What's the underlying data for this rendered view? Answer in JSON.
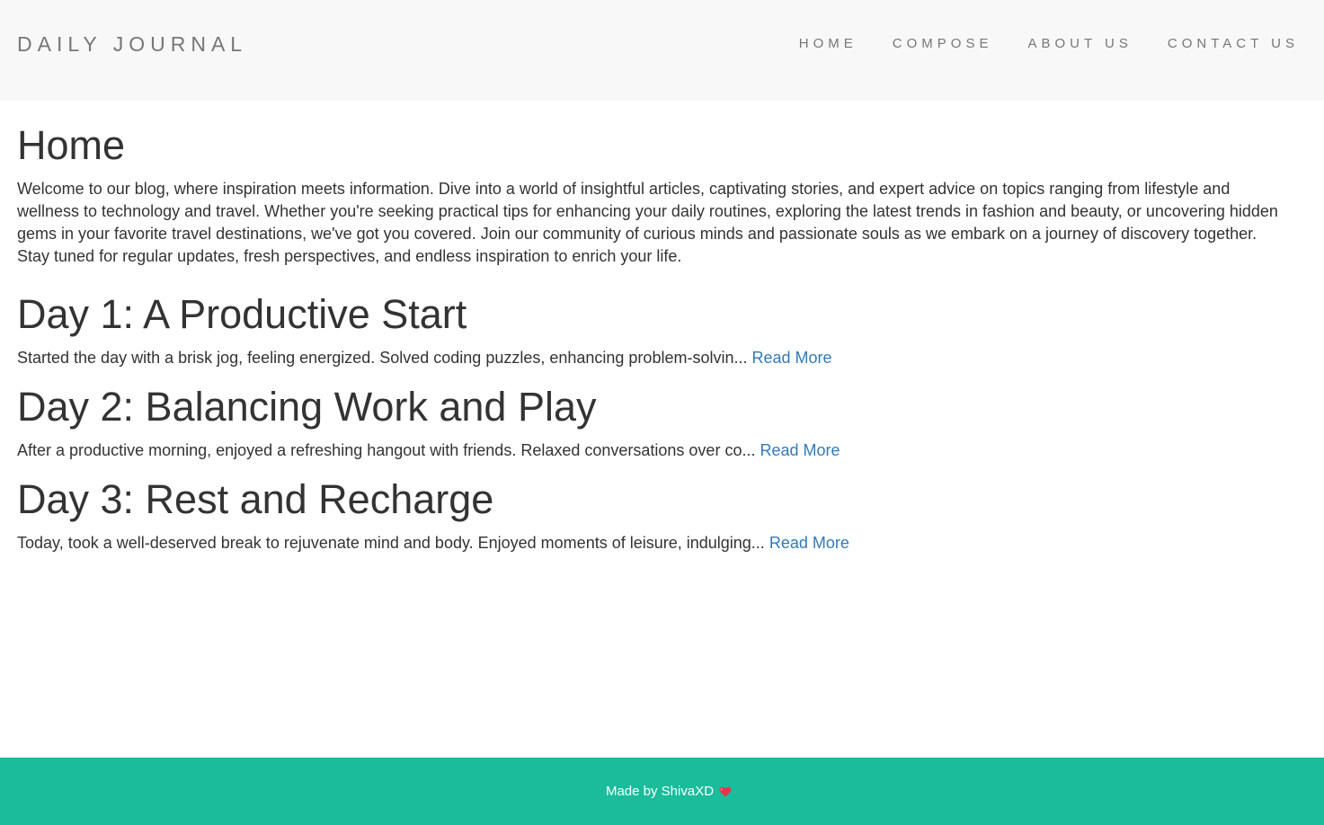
{
  "header": {
    "brand": "DAILY JOURNAL",
    "nav": [
      {
        "label": "HOME"
      },
      {
        "label": "COMPOSE"
      },
      {
        "label": "ABOUT US"
      },
      {
        "label": "CONTACT US"
      }
    ]
  },
  "main": {
    "title": "Home",
    "intro": "Welcome to our blog, where inspiration meets information. Dive into a world of insightful articles, captivating stories, and expert advice on topics ranging from lifestyle and wellness to technology and travel. Whether you're seeking practical tips for enhancing your daily routines, exploring the latest trends in fashion and beauty, or uncovering hidden gems in your favorite travel destinations, we've got you covered. Join our community of curious minds and passionate souls as we embark on a journey of discovery together. Stay tuned for regular updates, fresh perspectives, and endless inspiration to enrich your life.",
    "posts": [
      {
        "title": "Day 1: A Productive Start",
        "excerpt": "Started the day with a brisk jog, feeling energized. Solved coding puzzles, enhancing problem-solvin...",
        "link_label": "Read More"
      },
      {
        "title": "Day 2: Balancing Work and Play",
        "excerpt": "After a productive morning, enjoyed a refreshing hangout with friends. Relaxed conversations over co...",
        "link_label": "Read More"
      },
      {
        "title": "Day 3: Rest and Recharge",
        "excerpt": "Today, took a well-deserved break to rejuvenate mind and body. Enjoyed moments of leisure, indulging...",
        "link_label": "Read More"
      }
    ]
  },
  "footer": {
    "text": "Made by ShivaXD",
    "icon": "heart-icon"
  },
  "colors": {
    "navbar_bg": "#f8f8f8",
    "nav_text": "#777777",
    "body_text": "#333333",
    "link": "#337ab7",
    "footer_bg": "#1abc9c",
    "heart": "#e8334a"
  }
}
